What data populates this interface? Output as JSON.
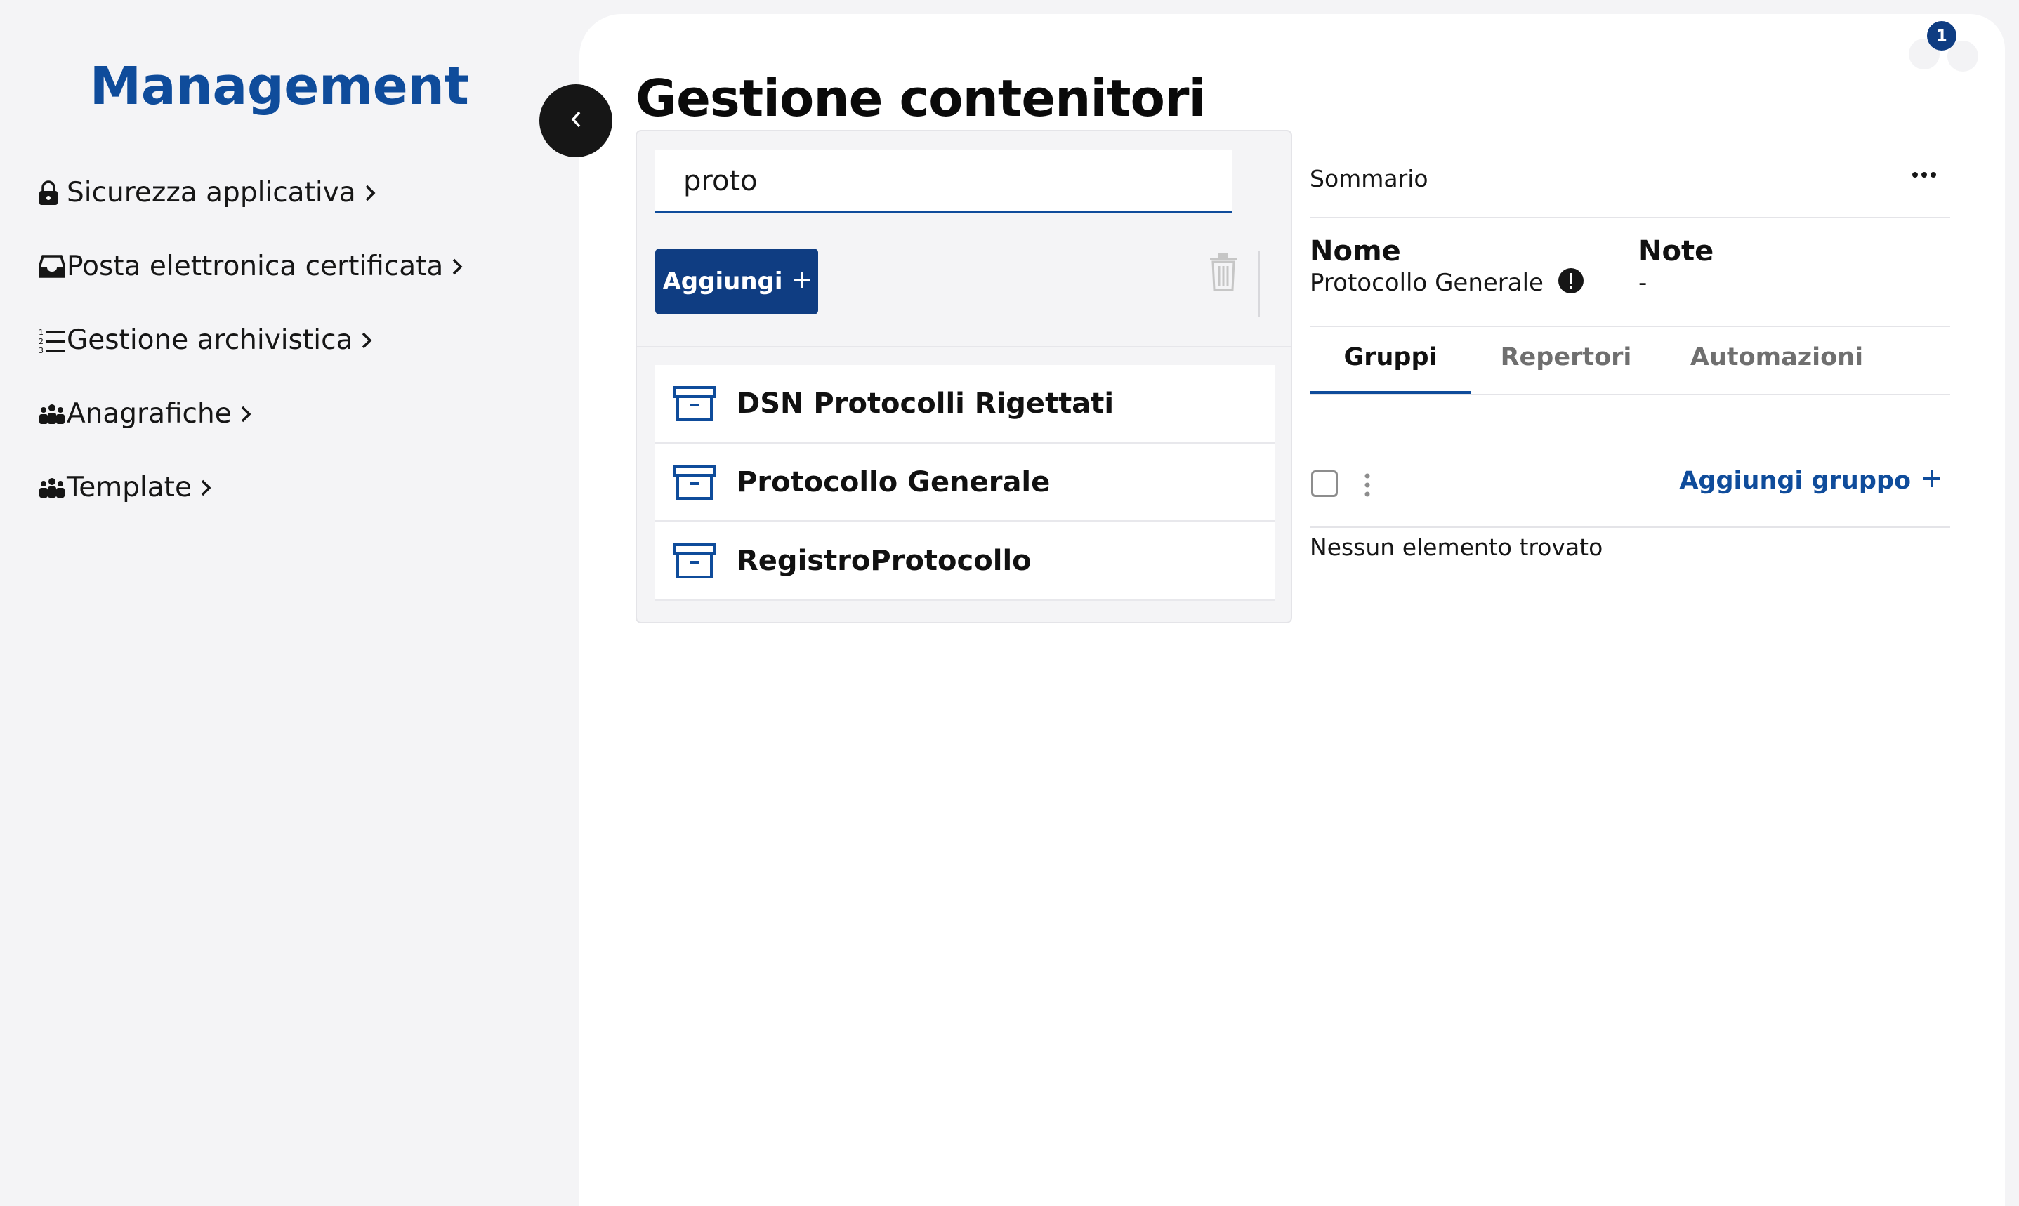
{
  "sidebar": {
    "brand": "Management",
    "items": [
      {
        "label": "Sicurezza applicativa",
        "icon": "lock-icon"
      },
      {
        "label": "Posta elettronica certificata",
        "icon": "inbox-icon"
      },
      {
        "label": "Gestione archivistica",
        "icon": "numbered-list-icon"
      },
      {
        "label": "Anagrafiche",
        "icon": "people-icon"
      },
      {
        "label": "Template",
        "icon": "people-icon"
      }
    ]
  },
  "header": {
    "title": "Gestione contenitori",
    "notification_count": "1"
  },
  "list_panel": {
    "search_value": "proto",
    "add_label": "Aggiungi",
    "items": [
      "DSN Protocolli Rigettati",
      "Protocollo Generale",
      "RegistroProtocollo"
    ]
  },
  "summary": {
    "heading": "Sommario",
    "name_label": "Nome",
    "name_value": "Protocollo Generale",
    "note_label": "Note",
    "note_value": "-",
    "tabs": [
      "Gruppi",
      "Repertori",
      "Automazioni"
    ],
    "active_tab": "Gruppi",
    "add_group_label": "Aggiungi gruppo",
    "empty_message": "Nessun elemento trovato"
  },
  "colors": {
    "brand": "#0f4c9b",
    "primary_button": "#0f3d82",
    "page_bg": "#f4f4f6"
  }
}
